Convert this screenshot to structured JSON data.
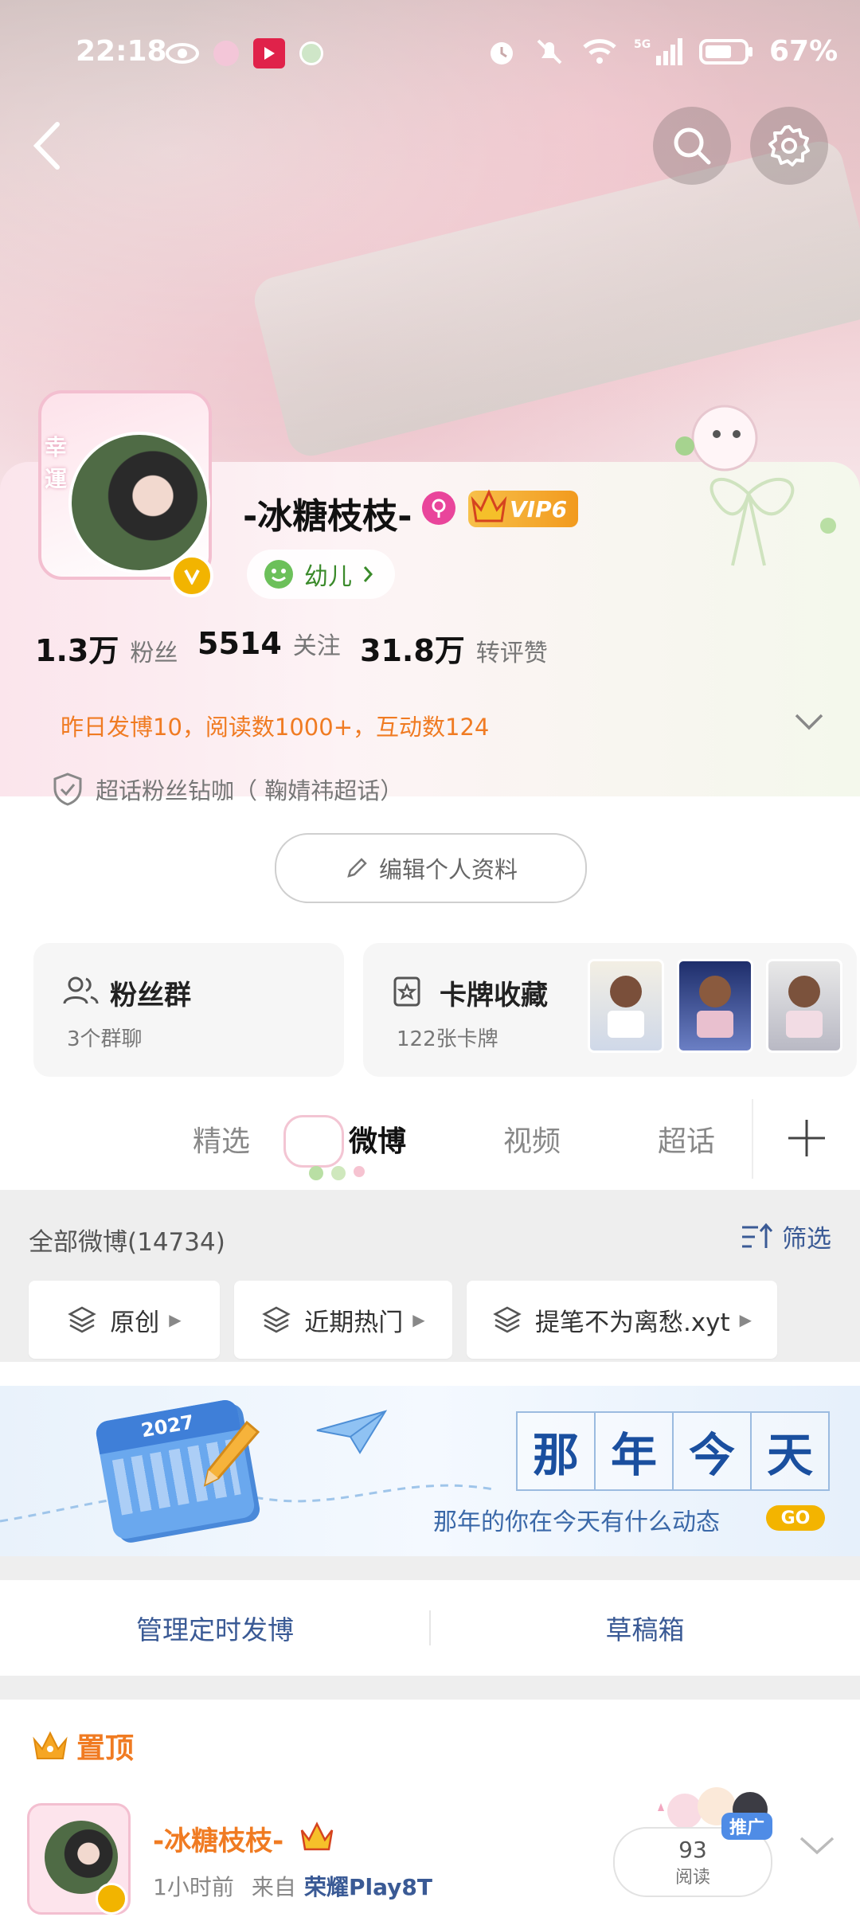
{
  "status_bar": {
    "time": "22:18",
    "battery": "67%"
  },
  "profile": {
    "username": "-冰糖枝枝-",
    "vip_label": "VIP6",
    "tag_label": "幼儿",
    "stats": [
      {
        "num": "1.3万",
        "label": "粉丝"
      },
      {
        "num": "5514",
        "label": "关注"
      },
      {
        "num": "31.8万",
        "label": "转评赞"
      }
    ],
    "summary": "昨日发博10，阅读数1000+，互动数124",
    "badge_text": "超话粉丝钻咖（  鞠婧祎超话）",
    "edit_button": "编辑个人资料"
  },
  "cards": {
    "fans_group": {
      "title": "粉丝群",
      "sub": "3个群聊"
    },
    "card_collection": {
      "title": "卡牌收藏",
      "sub": "122张卡牌"
    }
  },
  "tabs": [
    "精选",
    "微博",
    "视频",
    "超话"
  ],
  "feed": {
    "all_label": "全部微博(14734)",
    "filter_label": "筛选",
    "chips": [
      "原创",
      "近期热门",
      "提笔不为离愁.xyt"
    ]
  },
  "banner": {
    "title_chars": [
      "那",
      "年",
      "今",
      "天"
    ],
    "subtitle": "那年的你在今天有什么动态",
    "go": "GO",
    "calendar_year": "2027"
  },
  "actions": {
    "scheduled": "管理定时发博",
    "drafts": "草稿箱"
  },
  "pinned": {
    "label": "置顶",
    "username": "-冰糖枝枝-",
    "time": "1小时前",
    "source_prefix": "来自",
    "source": "荣耀Play8T",
    "promo": "推广",
    "reads_num": "93",
    "reads_label": "阅读"
  },
  "colors": {
    "orange": "#f07b22",
    "link_blue": "#3a5a95",
    "gold": "#f2b400"
  }
}
